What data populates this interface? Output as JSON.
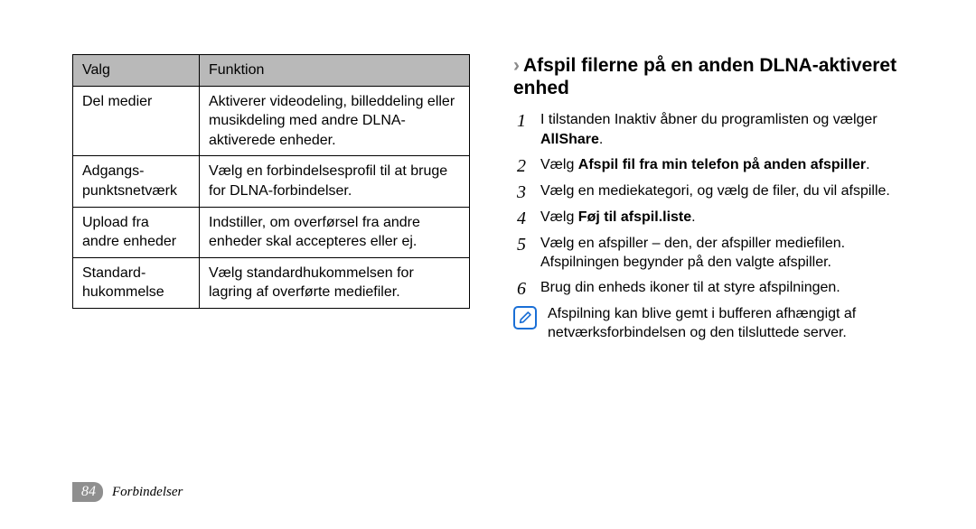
{
  "table": {
    "header": {
      "c1": "Valg",
      "c2": "Funktion"
    },
    "rows": [
      {
        "c1": "Del medier",
        "c2": "Aktiverer videodeling, billeddeling eller musikdeling med andre DLNA-aktiverede enheder."
      },
      {
        "c1": "Adgangs­punktsnetværk",
        "c2": "Vælg en forbindelsesprofil til at bruge for DLNA-forbindelser."
      },
      {
        "c1": "Upload fra andre enheder",
        "c2": "Indstiller, om overførsel fra andre enheder skal accepteres eller ej."
      },
      {
        "c1": "Standard­hukommelse",
        "c2": "Vælg standardhukommelsen for lagring af overførte mediefiler."
      }
    ]
  },
  "heading": {
    "arrow": "›",
    "text": "Afspil filerne på en anden DLNA-aktiveret enhed"
  },
  "steps": [
    {
      "n": "1",
      "pre": "I tilstanden Inaktiv åbner du programlisten og vælger ",
      "bold": "AllShare",
      "post": "."
    },
    {
      "n": "2",
      "pre": "Vælg ",
      "bold": "Afspil fil fra min telefon på anden afspiller",
      "post": "."
    },
    {
      "n": "3",
      "pre": "Vælg en mediekategori, og vælg de filer, du vil afspille.",
      "bold": "",
      "post": ""
    },
    {
      "n": "4",
      "pre": "Vælg ",
      "bold": "Føj til afspil.liste",
      "post": "."
    },
    {
      "n": "5",
      "pre": "Vælg en afspiller – den, der afspiller mediefilen. Afspilningen begynder på den valgte afspiller.",
      "bold": "",
      "post": ""
    },
    {
      "n": "6",
      "pre": "Brug din enheds ikoner til at styre afspilningen.",
      "bold": "",
      "post": ""
    }
  ],
  "note": "Afspilning kan blive gemt i bufferen afhængigt af netværksforbindelsen og den tilsluttede server.",
  "footer": {
    "page": "84",
    "section": "Forbindelser"
  }
}
